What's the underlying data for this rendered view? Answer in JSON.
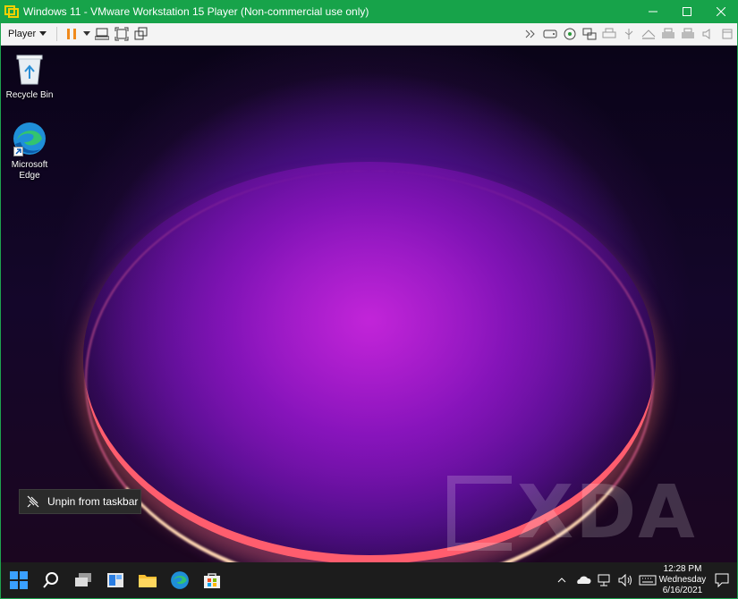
{
  "window": {
    "title": "Windows 11 - VMware Workstation 15 Player (Non-commercial use only)"
  },
  "toolbar": {
    "player_label": "Player"
  },
  "desktop": {
    "icons": [
      {
        "label": "Recycle Bin"
      },
      {
        "label_line1": "Microsoft",
        "label_line2": "Edge"
      }
    ]
  },
  "tooltip": {
    "text": "Unpin from taskbar"
  },
  "watermark": {
    "text": "XDA"
  },
  "taskbar": {
    "time": "12:28 PM",
    "day": "Wednesday",
    "date": "6/16/2021"
  },
  "colors": {
    "titlebar": "#17a34a",
    "taskbar": "#1c1c1c",
    "pause_accent": "#f08a1c"
  }
}
